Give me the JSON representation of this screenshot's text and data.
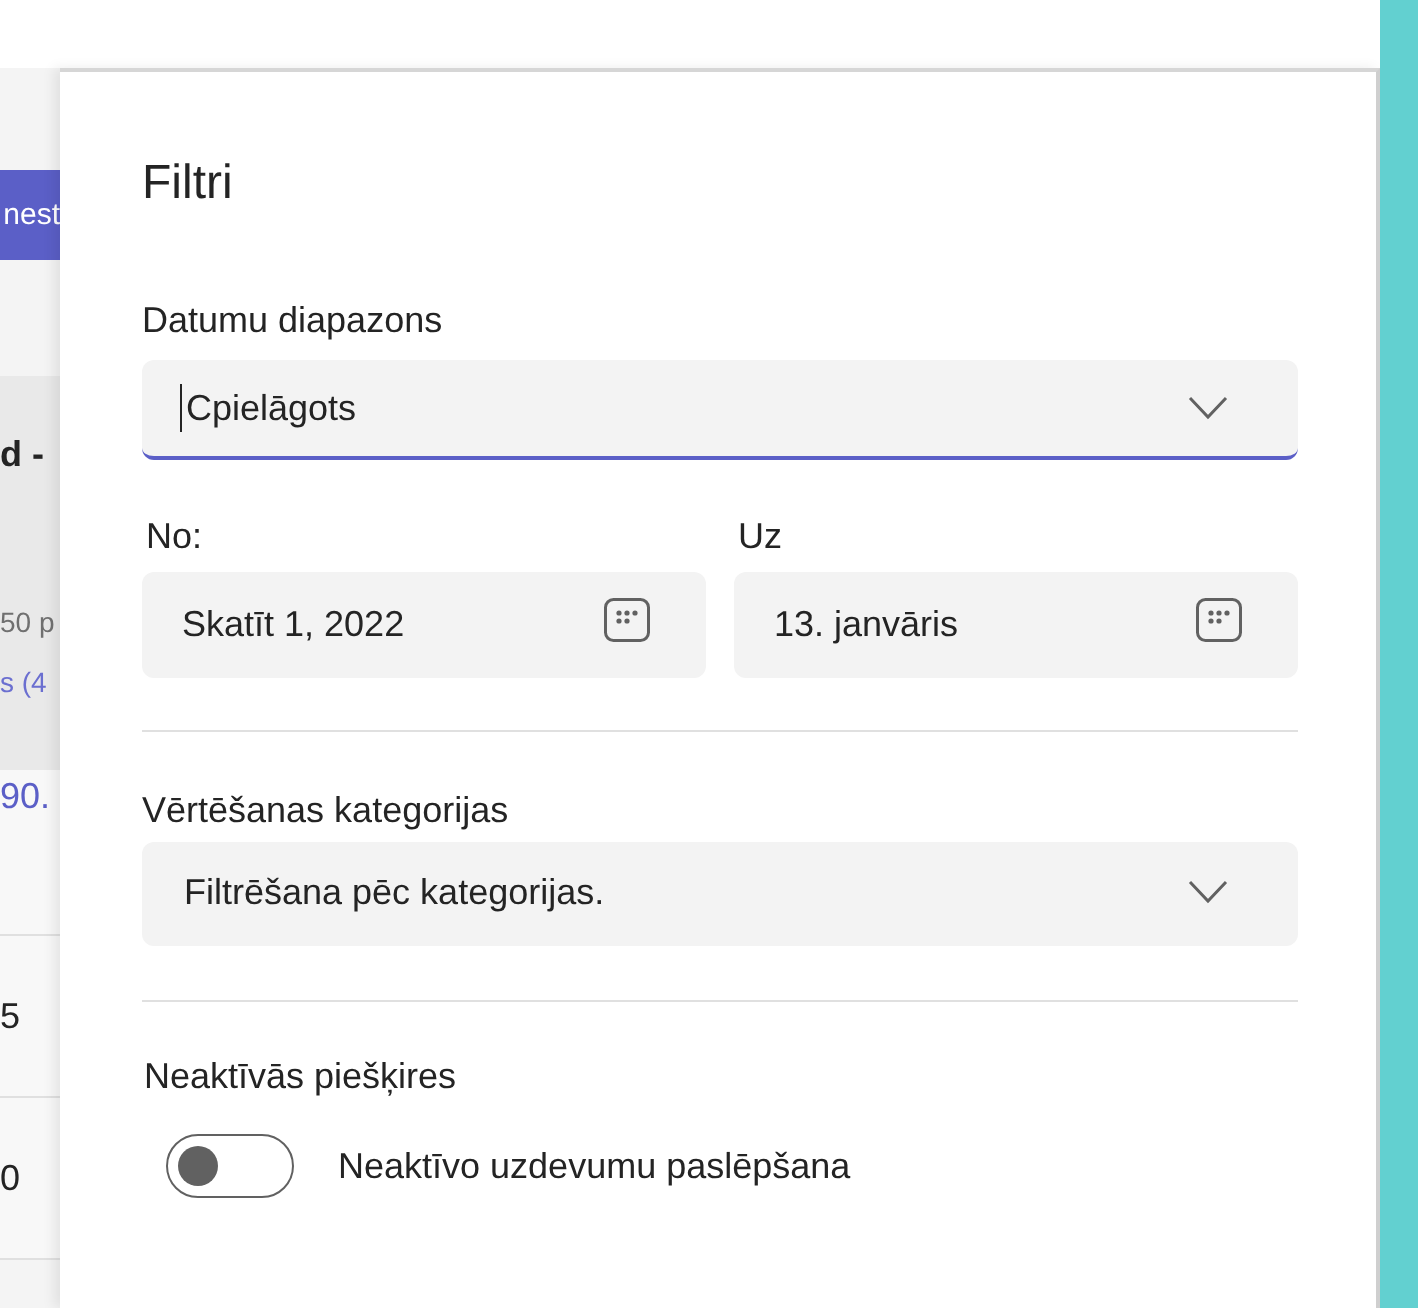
{
  "background": {
    "button": "nest",
    "card": {
      "title": "d -",
      "subtitle": "50 p",
      "link": "s (4"
    },
    "rows": [
      {
        "text": "90.",
        "kind": "link"
      },
      {
        "text": "5",
        "kind": "text"
      },
      {
        "text": "0",
        "kind": "text"
      }
    ]
  },
  "panel": {
    "title": "Filtri",
    "date_range": {
      "label": "Datumu diapazons",
      "value": "Cpielāgots",
      "focused": true
    },
    "from": {
      "label": "No:",
      "value": "Skatīt 1, 2022"
    },
    "to": {
      "label": "Uz",
      "value": "13. janvāris"
    },
    "categories": {
      "label": "Vērtēšanas kategorijas",
      "value": "Filtrēšana pēc kategorijas."
    },
    "inactive": {
      "label": "Neaktīvās piešķires",
      "toggle": {
        "label": "Neaktīvo uzdevumu paslēpšana",
        "on": false
      }
    }
  }
}
